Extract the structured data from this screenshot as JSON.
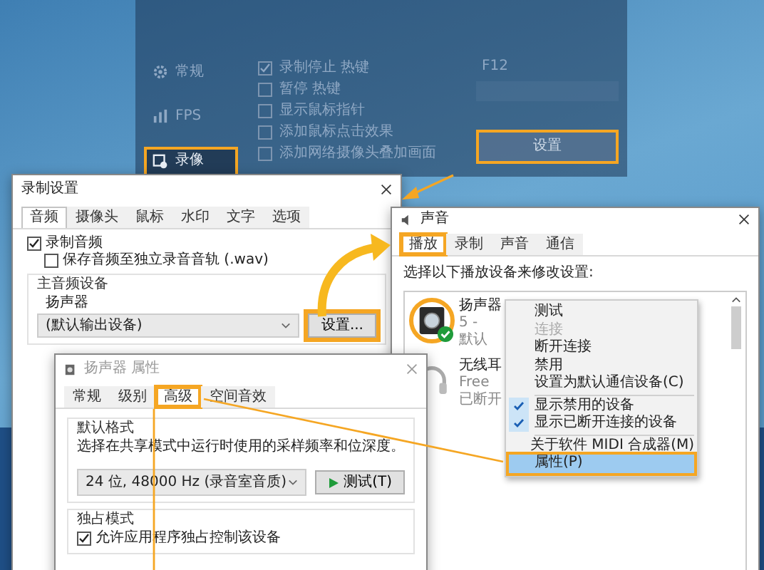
{
  "background_app": {
    "sidebar": [
      {
        "label": "常规",
        "highlighted": false
      },
      {
        "label": "FPS",
        "highlighted": false
      },
      {
        "label": "录像",
        "highlighted": true
      }
    ],
    "options": [
      {
        "label": "录制停止 热键",
        "checked": true
      },
      {
        "label": "暂停 热键",
        "checked": false
      },
      {
        "label": "显示鼠标指针",
        "checked": false
      },
      {
        "label": "添加鼠标点击效果",
        "checked": false
      },
      {
        "label": "添加网络摄像头叠加画面",
        "checked": false
      }
    ],
    "hotkey": "F12",
    "settings_button": {
      "label": "设置",
      "highlighted": true
    }
  },
  "record_settings": {
    "title": "录制设置",
    "tabs": [
      {
        "label": "音频",
        "selected": true
      },
      {
        "label": "摄像头",
        "selected": false
      },
      {
        "label": "鼠标",
        "selected": false
      },
      {
        "label": "水印",
        "selected": false
      },
      {
        "label": "文字",
        "selected": false
      },
      {
        "label": "选项",
        "selected": false
      }
    ],
    "checks": [
      {
        "label": "录制音频",
        "checked": true,
        "children": [
          {
            "label": "保存音频至独立录音音轨 (.wav)",
            "checked": false
          }
        ]
      }
    ],
    "group": {
      "title": "主音频设备",
      "device_label": "扬声器",
      "device_value": "(默认输出设备)",
      "settings_button": {
        "label": "设置...",
        "highlighted": true
      }
    }
  },
  "sound": {
    "title": "声音",
    "tabs": [
      {
        "label": "播放",
        "selected": true,
        "highlighted": true
      },
      {
        "label": "录制",
        "selected": false,
        "highlighted": false
      },
      {
        "label": "声音",
        "selected": false,
        "highlighted": false
      },
      {
        "label": "通信",
        "selected": false,
        "highlighted": false
      }
    ],
    "instruction": "选择以下播放设备来修改设置:",
    "devices": [
      {
        "kind": "speaker",
        "name": "扬声器",
        "detail": "5 -",
        "status": "默认",
        "is_default": true,
        "highlighted": true
      },
      {
        "kind": "headphones",
        "name": "无线耳",
        "detail": "Free",
        "status": "已断开",
        "is_default": false,
        "highlighted": false
      }
    ],
    "context_menu": [
      {
        "kind": "item",
        "label": "测试",
        "disabled": false,
        "checked": false,
        "highlighted": false
      },
      {
        "kind": "item",
        "label": "连接",
        "disabled": true,
        "checked": false,
        "highlighted": false
      },
      {
        "kind": "item",
        "label": "断开连接",
        "disabled": false,
        "checked": false,
        "highlighted": false
      },
      {
        "kind": "item",
        "label": "禁用",
        "disabled": false,
        "checked": false,
        "highlighted": false
      },
      {
        "kind": "item",
        "label": "设置为默认通信设备(C)",
        "disabled": false,
        "checked": false,
        "highlighted": false
      },
      {
        "kind": "separator"
      },
      {
        "kind": "item",
        "label": "显示禁用的设备",
        "disabled": false,
        "checked": true,
        "highlighted": false
      },
      {
        "kind": "item",
        "label": "显示已断开连接的设备",
        "disabled": false,
        "checked": true,
        "highlighted": false
      },
      {
        "kind": "separator"
      },
      {
        "kind": "item",
        "label": "关于软件 MIDI 合成器(M)",
        "disabled": false,
        "checked": false,
        "highlighted": false
      },
      {
        "kind": "item",
        "label": "属性(P)",
        "disabled": false,
        "checked": false,
        "highlighted": true
      }
    ]
  },
  "speaker_properties": {
    "title": "扬声器 属性",
    "tabs": [
      {
        "label": "常规",
        "selected": false,
        "highlighted": false
      },
      {
        "label": "级别",
        "selected": false,
        "highlighted": false
      },
      {
        "label": "高级",
        "selected": true,
        "highlighted": true
      },
      {
        "label": "空间音效",
        "selected": false,
        "highlighted": false
      }
    ],
    "default_format": {
      "title": "默认格式",
      "description": "选择在共享模式中运行时使用的采样频率和位深度。",
      "format": "24 位, 48000 Hz (录音室音质)",
      "test_button": "测试(T)"
    },
    "exclusive_mode": {
      "title": "独占模式",
      "options": [
        {
          "label": "允许应用程序独占控制该设备",
          "checked": true
        }
      ]
    }
  }
}
